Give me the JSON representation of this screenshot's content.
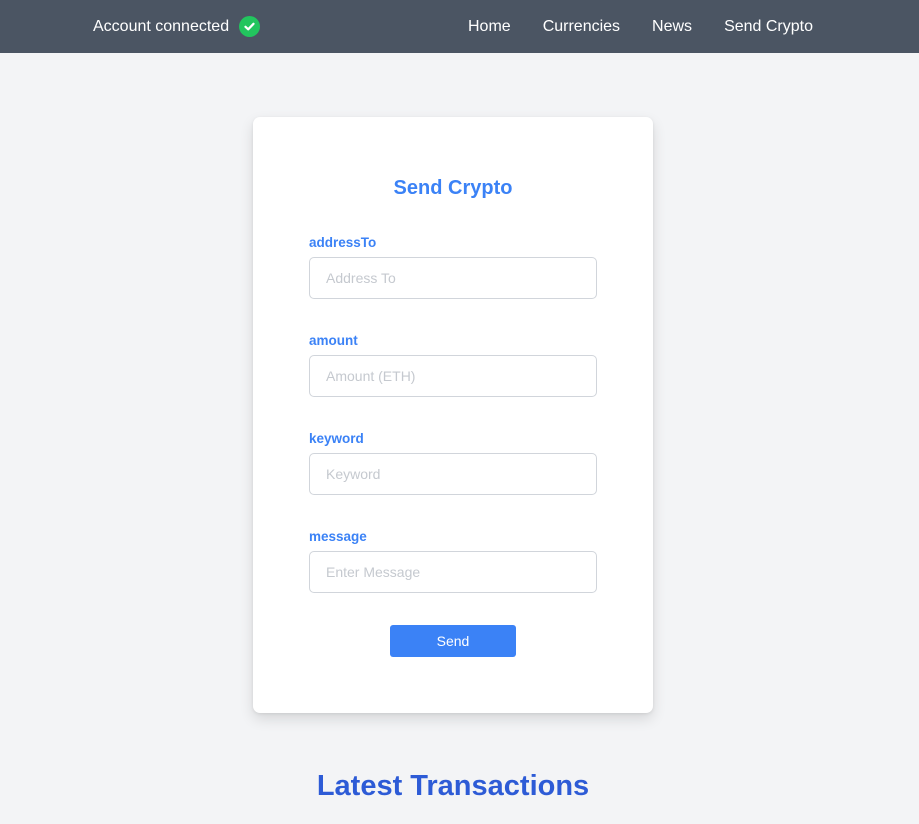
{
  "navbar": {
    "account_status": "Account connected",
    "links": [
      "Home",
      "Currencies",
      "News",
      "Send Crypto"
    ]
  },
  "form": {
    "title": "Send Crypto",
    "fields": [
      {
        "label": "addressTo",
        "placeholder": "Address To",
        "value": ""
      },
      {
        "label": "amount",
        "placeholder": "Amount (ETH)",
        "value": ""
      },
      {
        "label": "keyword",
        "placeholder": "Keyword",
        "value": ""
      },
      {
        "label": "message",
        "placeholder": "Enter Message",
        "value": ""
      }
    ],
    "submit_label": "Send"
  },
  "transactions": {
    "title": "Latest Transactions"
  },
  "icons": {
    "account_status": "check-circle-icon"
  },
  "colors": {
    "navbar": "#4b5563",
    "accent": "#3b82f6",
    "success": "#22c55e",
    "heading": "#2d5bd6",
    "background": "#f3f4f6"
  }
}
